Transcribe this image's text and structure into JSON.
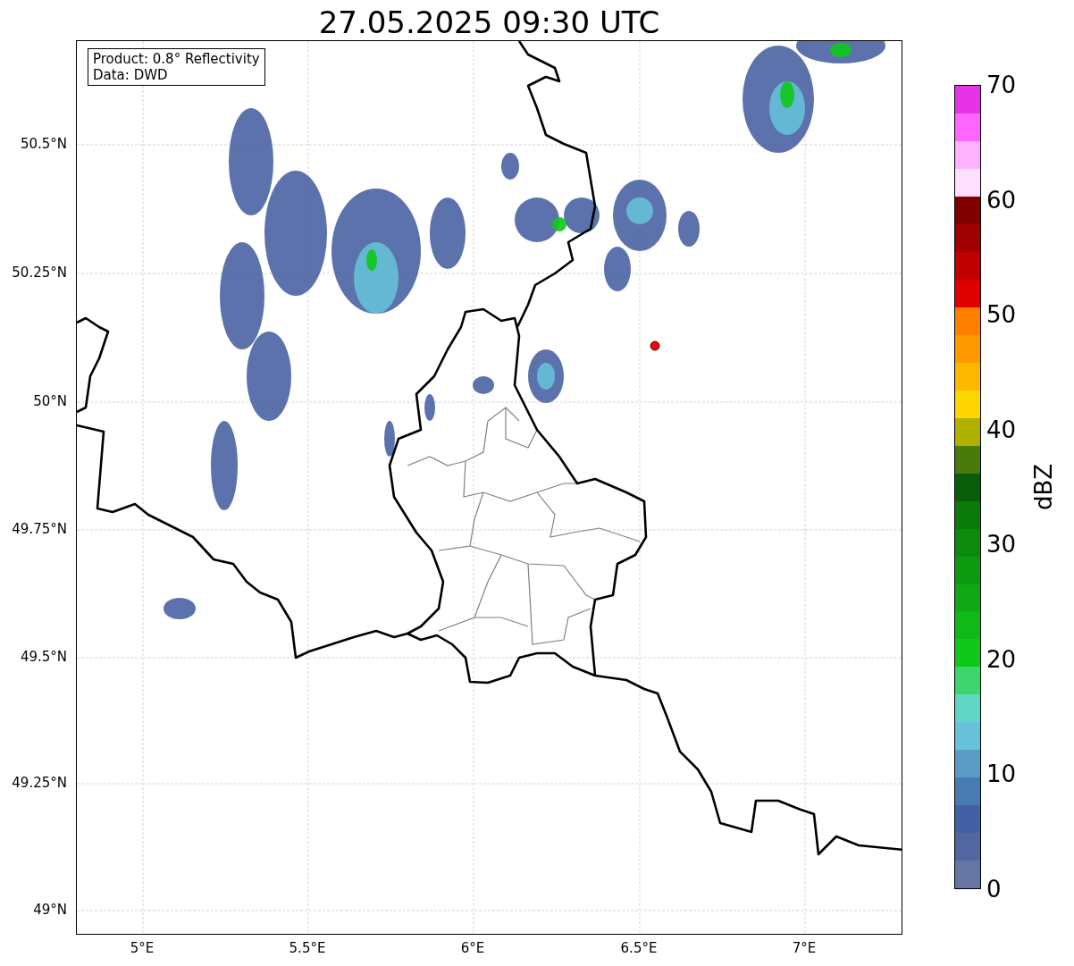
{
  "title": "27.05.2025 09:30 UTC",
  "legend": {
    "lines": [
      "Product: 0.8° Reflectivity",
      "Data: DWD"
    ]
  },
  "y_ticks": [
    "50.5°N",
    "50.25°N",
    "50°N",
    "49.75°N",
    "49.5°N",
    "49.25°N",
    "49°N"
  ],
  "x_ticks": [
    "5°E",
    "5.5°E",
    "6°E",
    "6.5°E",
    "7°E"
  ],
  "colorbar": {
    "label": "dBZ",
    "ticks": [
      "70",
      "60",
      "50",
      "40",
      "30",
      "20",
      "10",
      "0"
    ],
    "bands": [
      {
        "color": "#6775a5"
      },
      {
        "color": "#5266a0"
      },
      {
        "color": "#4460a4"
      },
      {
        "color": "#4a7bb0"
      },
      {
        "color": "#5a9cc6"
      },
      {
        "color": "#68c2dc"
      },
      {
        "color": "#60d6c4"
      },
      {
        "color": "#3dd66e"
      },
      {
        "color": "#10c81a"
      },
      {
        "color": "#10b818"
      },
      {
        "color": "#10a814"
      },
      {
        "color": "#0e9a10"
      },
      {
        "color": "#0c8a0c"
      },
      {
        "color": "#0a7a0a"
      },
      {
        "color": "#085e08"
      },
      {
        "color": "#4a7a0a"
      },
      {
        "color": "#b0b000"
      },
      {
        "color": "#ffd700"
      },
      {
        "color": "#ffb800"
      },
      {
        "color": "#ff9900"
      },
      {
        "color": "#ff7f00"
      },
      {
        "color": "#e00000"
      },
      {
        "color": "#c00000"
      },
      {
        "color": "#a00000"
      },
      {
        "color": "#800000"
      },
      {
        "color": "#ffe0ff"
      },
      {
        "color": "#ffb3ff"
      },
      {
        "color": "#ff66ff"
      },
      {
        "color": "#e633e6"
      }
    ]
  }
}
